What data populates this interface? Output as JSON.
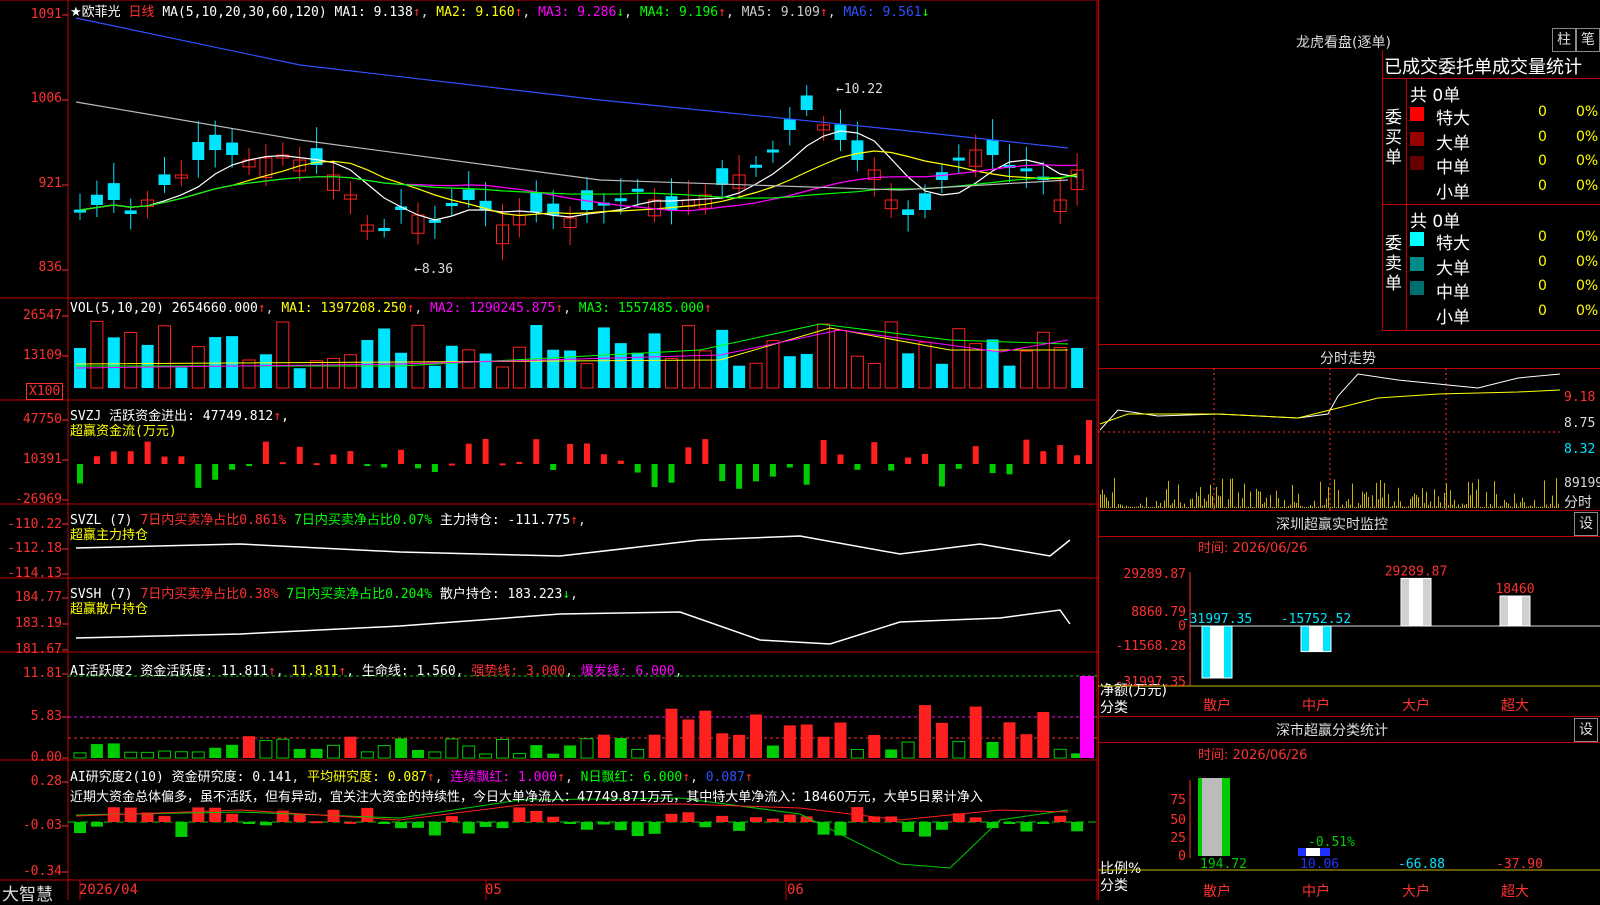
{
  "app": {
    "name": "大智慧",
    "title": "★欧菲光",
    "period_label": "日线"
  },
  "colors": {
    "up": "#ff2020",
    "down": "#00e5ff",
    "grid": "#c00000",
    "text_red": "#ff3030"
  },
  "main": {
    "ma_header": [
      "MA(5,10,20,30,60,120)",
      "MA1: 9.138",
      "MA2: 9.160",
      "MA3: 9.286",
      "MA4: 9.196",
      "MA5: 9.109",
      "MA6: 9.561"
    ],
    "y_labels": [
      "1091",
      "1006",
      "921",
      "836"
    ],
    "high_label": "10.22",
    "low_label": "8.36"
  },
  "volume": {
    "header": [
      "VOL(5,10,20)",
      "2654660.000",
      "MA1: 1397208.250",
      "MA2: 1290245.875",
      "MA3: 1557485.000"
    ],
    "y_labels": [
      "26547",
      "13109"
    ],
    "unit": "X100"
  },
  "svzj": {
    "header1": "SVZJ  活跃资金进出: 47749.812",
    "header2": "超赢资金流(万元)",
    "y_labels": [
      "47750",
      "10391",
      "-26969"
    ]
  },
  "svzl": {
    "header_a": "SVZL (7)",
    "header_b": "7日内买卖净占比0.861%",
    "header_c": "7日内买卖净占比0.07%",
    "header_d": "主力持仓: -111.775",
    "header2": "超赢主力持仓",
    "y_labels": [
      "-110.22",
      "-112.18",
      "-114.13"
    ]
  },
  "svsh": {
    "header_a": "SVSH (7)",
    "header_b": "7日内买卖净占比0.38%",
    "header_c": "7日内买卖净占比0.204%",
    "header_d": "散户持仓: 183.223",
    "header2": "超赢散户持仓",
    "y_labels": [
      "184.77",
      "183.19",
      "181.67"
    ]
  },
  "ai1": {
    "header_a": "AI活跃度2",
    "header_b": "资金活跃度: 11.811",
    "header_c": "11.811",
    "header_d": "生命线: 1.560",
    "header_e": "强势线: 3.000",
    "header_f": "爆发线: 6.000",
    "y_labels": [
      "11.81",
      "5.83",
      "0.00"
    ]
  },
  "ai2": {
    "header_a": "AI研究度2(10)",
    "header_b": "资金研究度: 0.141",
    "header_c": "平均研究度: 0.087",
    "header_d": "连续飘红: 1.000",
    "header_e": "N日飘红: 6.000",
    "header_f": "0.087",
    "comment": "近期大资金总体偏多，虽不活跃，但有异动，宜关注大资金的持续性，今日大单净流入：47749.871万元，其中特大单净流入：18460万元，大单5日累计净入",
    "y_labels": [
      "0.28",
      "-0.03",
      "-0.34"
    ]
  },
  "date_axis": [
    "2026/04",
    "05",
    "06"
  ],
  "right": {
    "tiger": {
      "title": "龙虎看盘(逐单)",
      "btn1": "柱",
      "btn2": "笔",
      "stat_title": "已成交委托单成交量统计"
    },
    "buy": {
      "label": "委买单",
      "total": "共 0单",
      "rows": [
        {
          "name": "特大",
          "count": "0",
          "pct": "0%",
          "color": "#ff0000"
        },
        {
          "name": "大单",
          "count": "0",
          "pct": "0%",
          "color": "#990000"
        },
        {
          "name": "中单",
          "count": "0",
          "pct": "0%",
          "color": "#660000"
        },
        {
          "name": "小单",
          "count": "0",
          "pct": "0%",
          "color": "#000000"
        }
      ]
    },
    "sell": {
      "label": "委卖单",
      "total": "共 0单",
      "rows": [
        {
          "name": "特大",
          "count": "0",
          "pct": "0%",
          "color": "#00ffff"
        },
        {
          "name": "大单",
          "count": "0",
          "pct": "0%",
          "color": "#008b8b"
        },
        {
          "name": "中单",
          "count": "0",
          "pct": "0%",
          "color": "#006e6e"
        },
        {
          "name": "小单",
          "count": "0",
          "pct": "0%",
          "color": "#000000"
        }
      ]
    },
    "intraday": {
      "title": "分时走势",
      "y_labels": [
        "9.18",
        "8.75",
        "8.32"
      ],
      "vol_label": "89199",
      "sub_label": "分时"
    },
    "monitor": {
      "title": "深圳超赢实时监控",
      "set": "设",
      "time": "时间: 2026/06/26",
      "y_labels": [
        "29289.87",
        "8860.79",
        "0",
        "-11568.28",
        "-31997.35"
      ],
      "axis_name": "净额(万元)",
      "axis_sub": "分类"
    },
    "classify": {
      "title": "深市超赢分类统计",
      "set": "设",
      "time": "时间: 2026/06/26",
      "y_labels": [
        "75",
        "50",
        "25",
        "0"
      ],
      "axis_name": "比例%",
      "axis_sub": "分类"
    }
  },
  "chart_data": [
    {
      "type": "bar",
      "title": "深圳超赢实时监控",
      "categories": [
        "散户",
        "中户",
        "大户",
        "超大"
      ],
      "values": [
        -31997.35,
        -15752.52,
        29289.87,
        18460
      ],
      "ylabel": "净额(万元)",
      "ylim": [
        -31997.35,
        29289.87
      ]
    },
    {
      "type": "bar",
      "title": "深市超赢分类统计",
      "categories": [
        "散户",
        "中户",
        "大户",
        "超大"
      ],
      "values": [
        194.72,
        10.06,
        -66.88,
        -37.9
      ],
      "annotation": "-0.51%",
      "ylabel": "比例%",
      "ylim": [
        0,
        75
      ]
    }
  ]
}
